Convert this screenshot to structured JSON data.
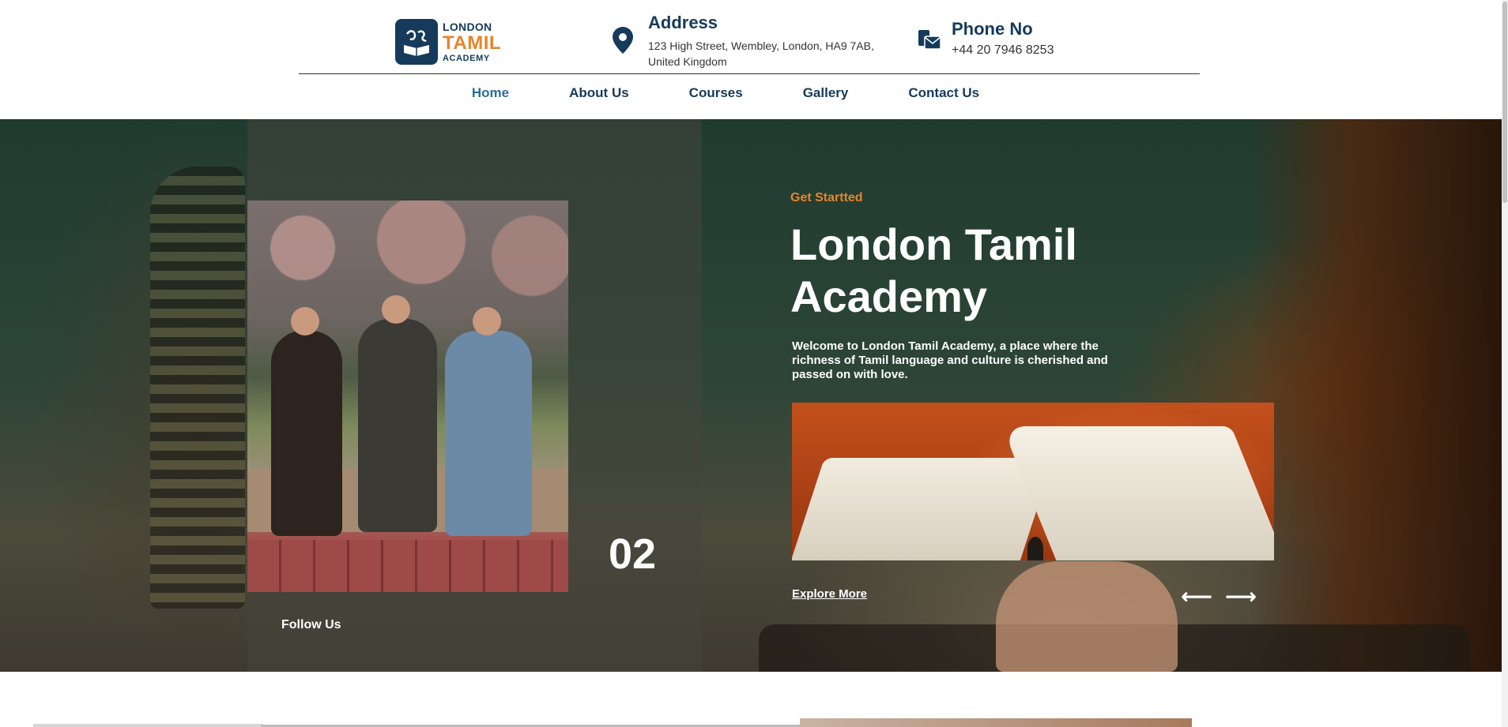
{
  "logo": {
    "line1": "LONDON",
    "line2": "TAMIL",
    "line3": "ACADEMY"
  },
  "header": {
    "address_title": "Address",
    "address_text": "123 High Street, Wembley, London, HA9 7AB, United Kingdom",
    "phone_title": "Phone No",
    "phone_text": "+44 20 7946 8253"
  },
  "nav": {
    "items": [
      {
        "label": "Home",
        "active": true
      },
      {
        "label": "About Us"
      },
      {
        "label": "Courses"
      },
      {
        "label": "Gallery"
      },
      {
        "label": "Contact Us"
      }
    ]
  },
  "hero": {
    "eyebrow": "Get Startted",
    "title": "London Tamil Academy",
    "description": "Welcome to London Tamil Academy, a place where the richness of Tamil language and culture is cherished and passed on with love.",
    "slide_counter": "02",
    "follow_label": "Follow Us",
    "explore_label": "Explore More",
    "prev_arrow": "⟵",
    "next_arrow": "⟶"
  },
  "icons": {
    "location": "location-pin-icon",
    "phone": "phone-envelope-icon",
    "prev": "arrow-left-icon",
    "next": "arrow-right-icon"
  },
  "colors": {
    "brand": "#153a5b",
    "accent": "#e8842b"
  }
}
